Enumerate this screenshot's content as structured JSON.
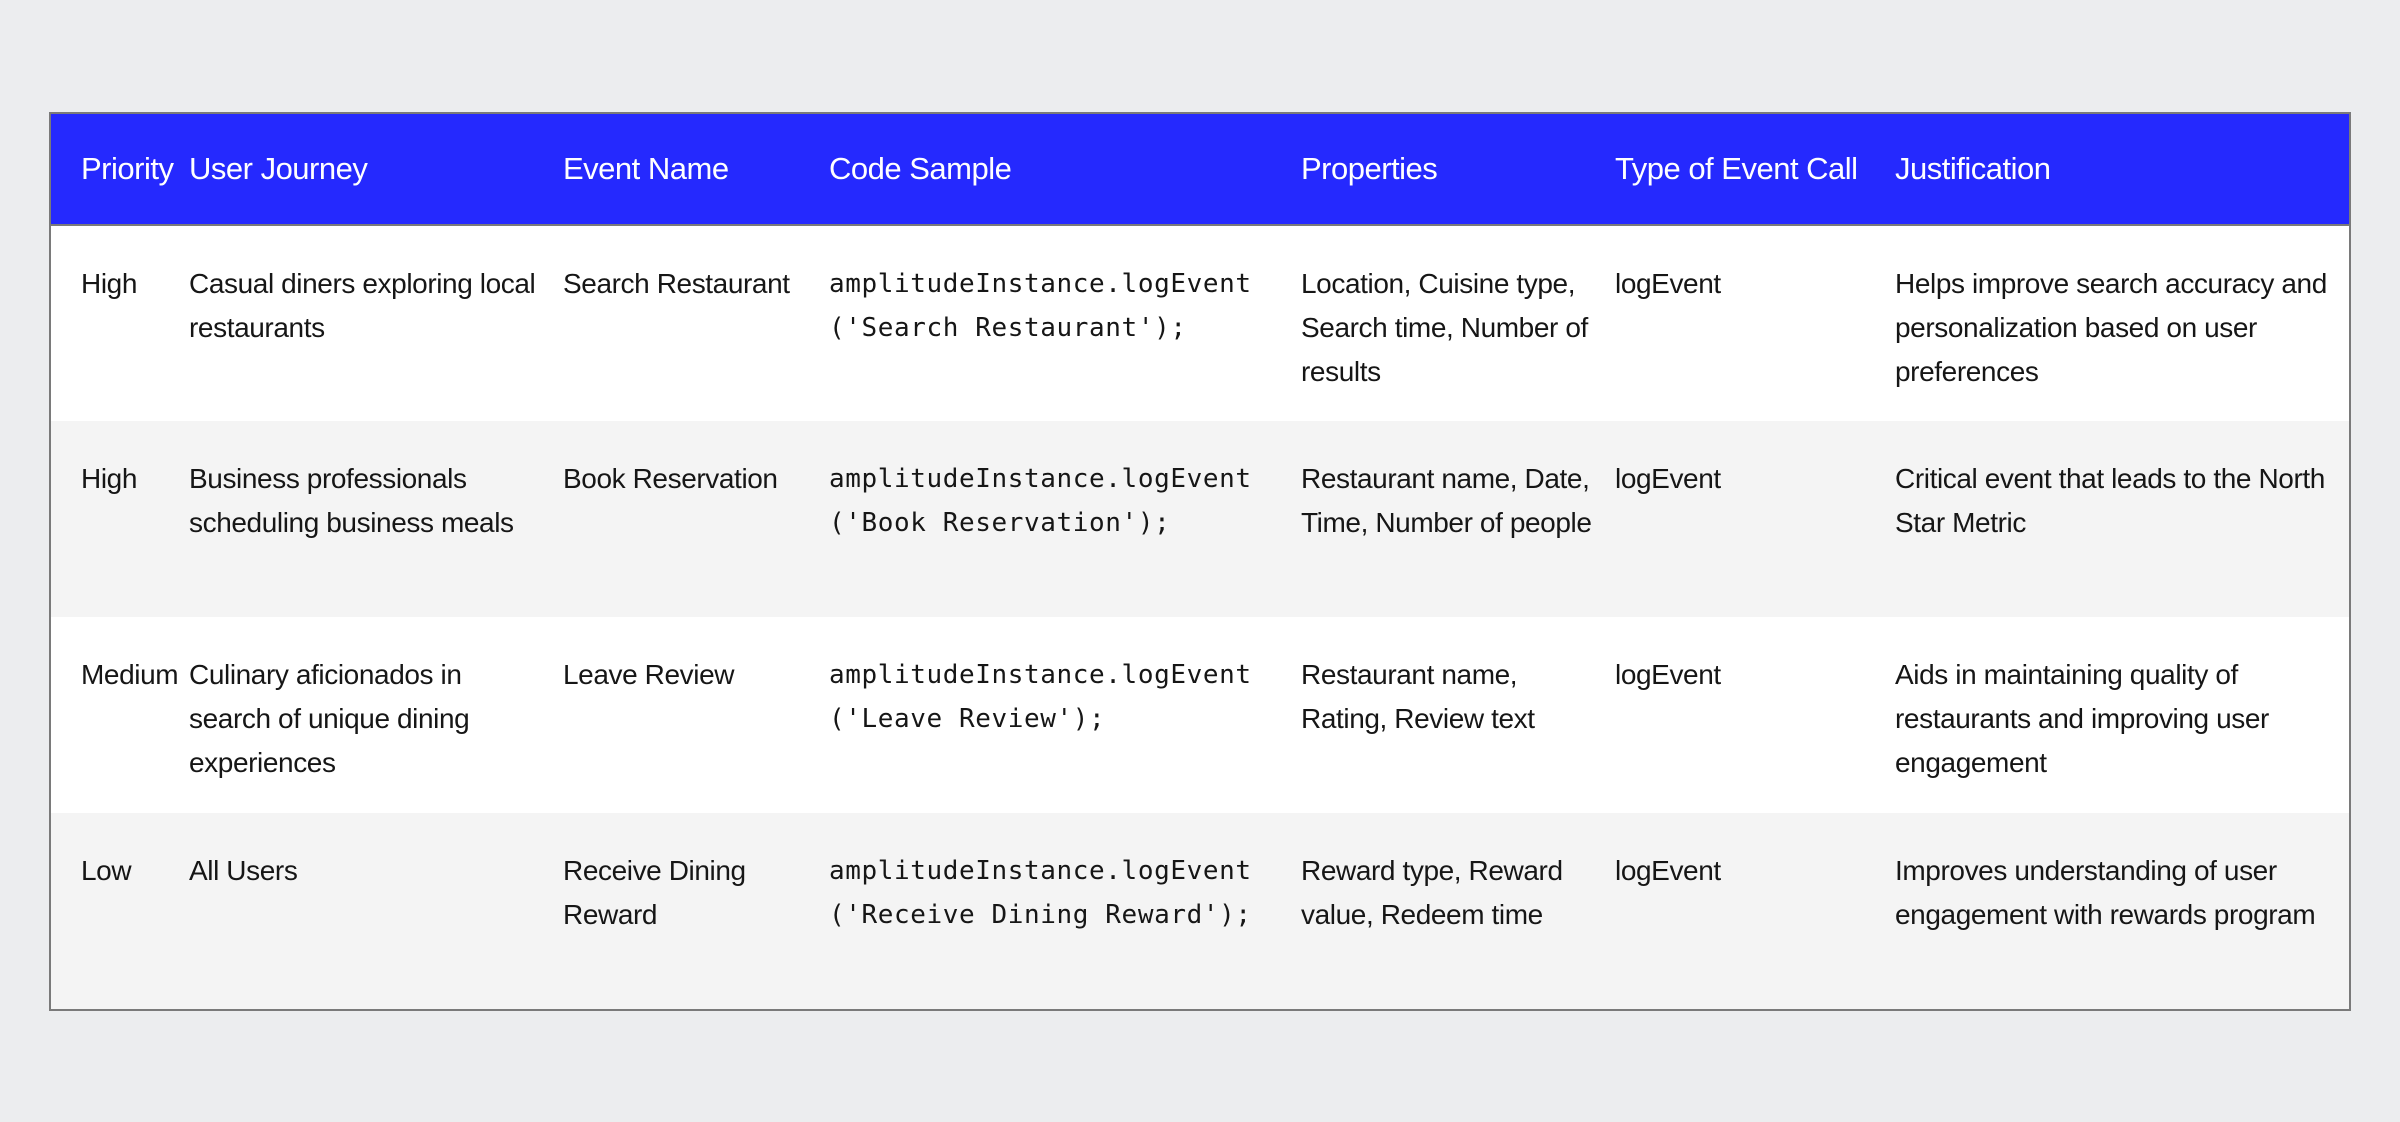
{
  "table": {
    "colors": {
      "header_bg": "#2529fe",
      "header_text": "#ffffff",
      "row_alt_bg": "#f4f4f4",
      "page_bg": "#ecedef",
      "border": "#7a7a7a"
    },
    "headers": [
      "Priority",
      "User Journey",
      "Event Name",
      "Code Sample",
      "Properties",
      "Type of Event Call",
      "Justification"
    ],
    "rows": [
      {
        "priority": "High",
        "user_journey": "Casual diners exploring local restaurants",
        "event_name": "Search Restaurant",
        "code_sample": "amplitudeInstance.logEvent\n('Search Restaurant');",
        "properties": "Location, Cuisine type, Search time, Number of results",
        "event_call_type": "logEvent",
        "justification": "Helps improve search accuracy and personalization based on user preferences"
      },
      {
        "priority": "High",
        "user_journey": "Business professionals scheduling business meals",
        "event_name": "Book Reservation",
        "code_sample": "amplitudeInstance.logEvent\n('Book Reservation');",
        "properties": "Restaurant name, Date, Time, Number of people",
        "event_call_type": "logEvent",
        "justification": "Critical event that leads to the North Star Metric"
      },
      {
        "priority": "Medium",
        "user_journey": "Culinary aficionados in search of unique dining experiences",
        "event_name": "Leave Review",
        "code_sample": "amplitudeInstance.logEvent\n('Leave Review');",
        "properties": "Restaurant name, Rating, Review text",
        "event_call_type": "logEvent",
        "justification": "Aids in maintaining quality of restaurants and improving user engagement"
      },
      {
        "priority": "Low",
        "user_journey": "All Users",
        "event_name": "Receive Dining Reward",
        "code_sample": "amplitudeInstance.logEvent\n('Receive Dining Reward');",
        "properties": "Reward type, Reward value, Redeem time",
        "event_call_type": "logEvent",
        "justification": "Improves understanding of user engagement with rewards program"
      }
    ]
  }
}
